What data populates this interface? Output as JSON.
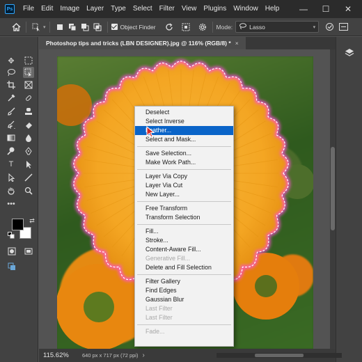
{
  "app": {
    "logo_text": "Ps"
  },
  "menubar": {
    "items": [
      "File",
      "Edit",
      "Image",
      "Layer",
      "Type",
      "Select",
      "Filter",
      "View",
      "Plugins",
      "Window",
      "Help"
    ]
  },
  "window_controls": {
    "minimize": "—",
    "maximize": "☐",
    "close": "✕"
  },
  "options_bar": {
    "object_finder_label": "Object Finder",
    "mode_label": "Mode:",
    "mode_value": "Lasso"
  },
  "document_tab": {
    "title": "Photoshop tips and tricks (LBN DESIGNER).jpg @ 116% (RGB/8) *",
    "close": "×"
  },
  "context_menu": {
    "groups": [
      [
        "Deselect",
        "Select Inverse",
        "Feather...",
        "Select and Mask..."
      ],
      [
        "Save Selection...",
        "Make Work Path..."
      ],
      [
        "Layer Via Copy",
        "Layer Via Cut",
        "New Layer..."
      ],
      [
        "Free Transform",
        "Transform Selection"
      ],
      [
        "Fill...",
        "Stroke...",
        "Content-Aware Fill...",
        "Generative Fill...",
        "Delete and Fill Selection"
      ],
      [
        "Filter Gallery",
        "Find Edges",
        "Gaussian Blur",
        "Last Filter",
        "Last Filter"
      ],
      [
        "Fade..."
      ]
    ],
    "highlighted": "Feather...",
    "disabled": [
      "Generative Fill...",
      "Last Filter",
      "Fade..."
    ]
  },
  "status_bar": {
    "zoom": "115.62%",
    "doc_info": "640 px x 717 px (72 ppi)",
    "expand": "›"
  },
  "colors": {
    "foreground": "#000000",
    "background": "#ffffff",
    "highlight": "#0a64c8",
    "flower": "#f4a623",
    "selection_glow": "#ff4fd8"
  }
}
